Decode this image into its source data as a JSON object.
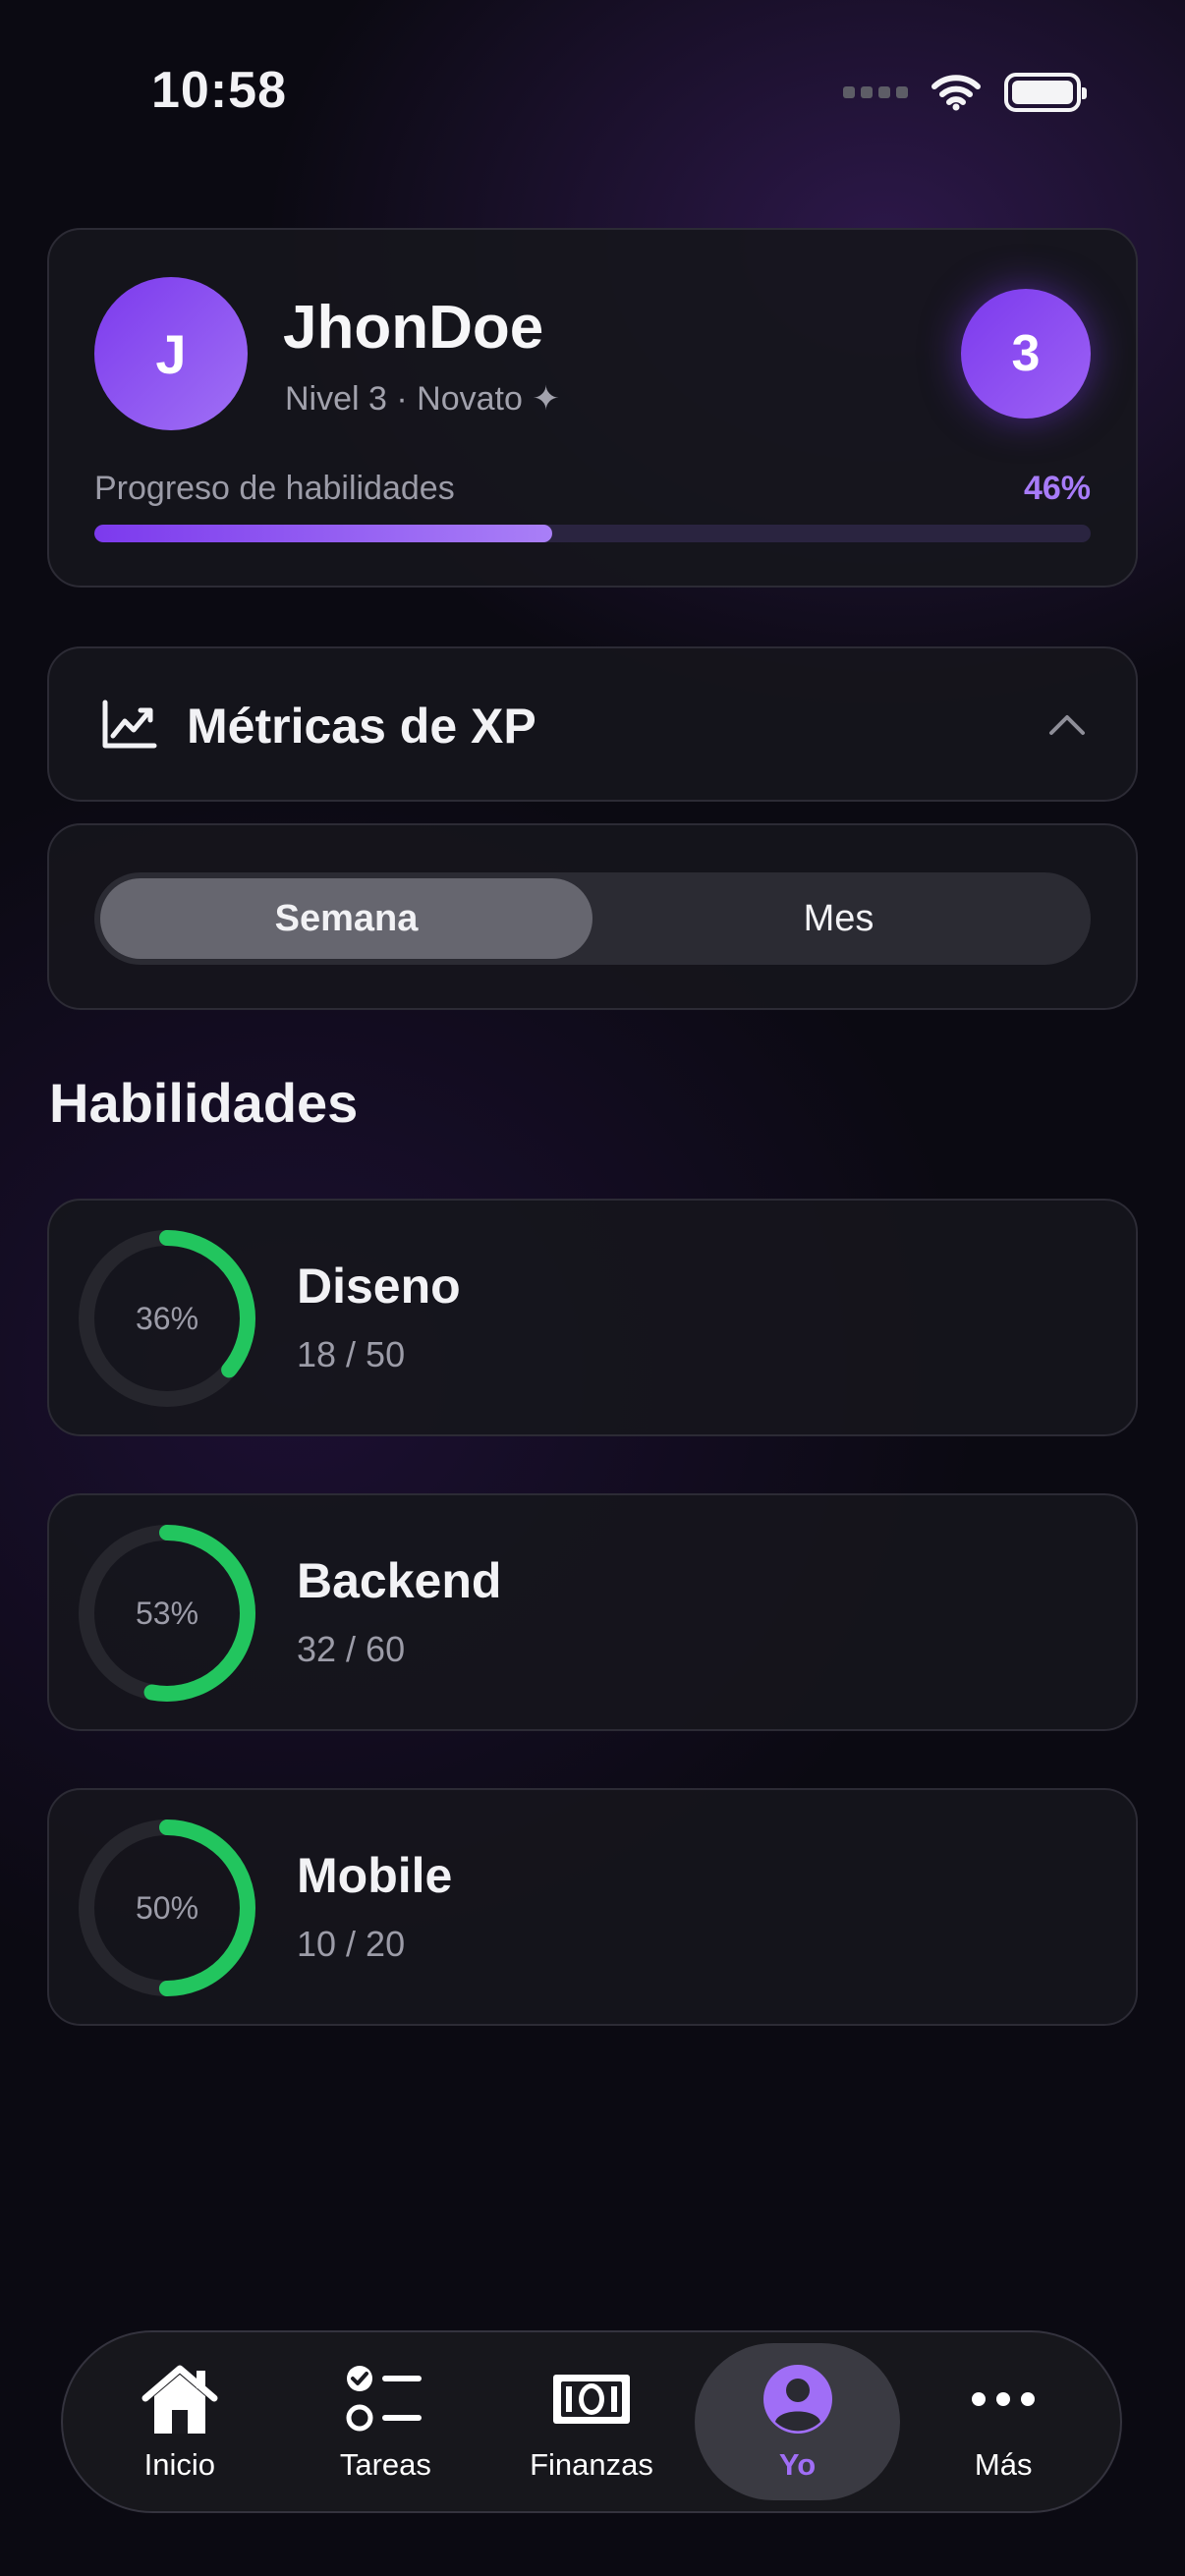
{
  "status_bar": {
    "time": "10:58"
  },
  "profile": {
    "avatar_initial": "J",
    "name": "JhonDoe",
    "subtitle": "Nivel 3 · Novato ✦",
    "level": "3",
    "progress_label": "Progreso de habilidades",
    "progress_text": "46%",
    "progress_fraction": 0.46
  },
  "metrics": {
    "title": "Métricas de XP"
  },
  "period": {
    "options": [
      "Semana",
      "Mes"
    ],
    "selected": "Semana"
  },
  "skills_section": {
    "title": "Habilidades",
    "items": [
      {
        "pct_text": "36%",
        "fraction": 0.36,
        "name": "Diseno",
        "count": "18 / 50"
      },
      {
        "pct_text": "53%",
        "fraction": 0.53,
        "name": "Backend",
        "count": "32 / 60"
      },
      {
        "pct_text": "50%",
        "fraction": 0.5,
        "name": "Mobile",
        "count": "10 / 20"
      }
    ]
  },
  "tabbar": {
    "items": [
      {
        "label": "Inicio",
        "icon": "home-icon"
      },
      {
        "label": "Tareas",
        "icon": "task-list-icon"
      },
      {
        "label": "Finanzas",
        "icon": "banknote-icon"
      },
      {
        "label": "Yo",
        "icon": "profile-icon"
      },
      {
        "label": "Más",
        "icon": "more-icon"
      }
    ],
    "active": "Yo"
  },
  "colors": {
    "accent": "#7c3aed",
    "accent_light": "#a06ef6",
    "ring_progress": "#22c55e",
    "ring_track": "#26262d"
  }
}
